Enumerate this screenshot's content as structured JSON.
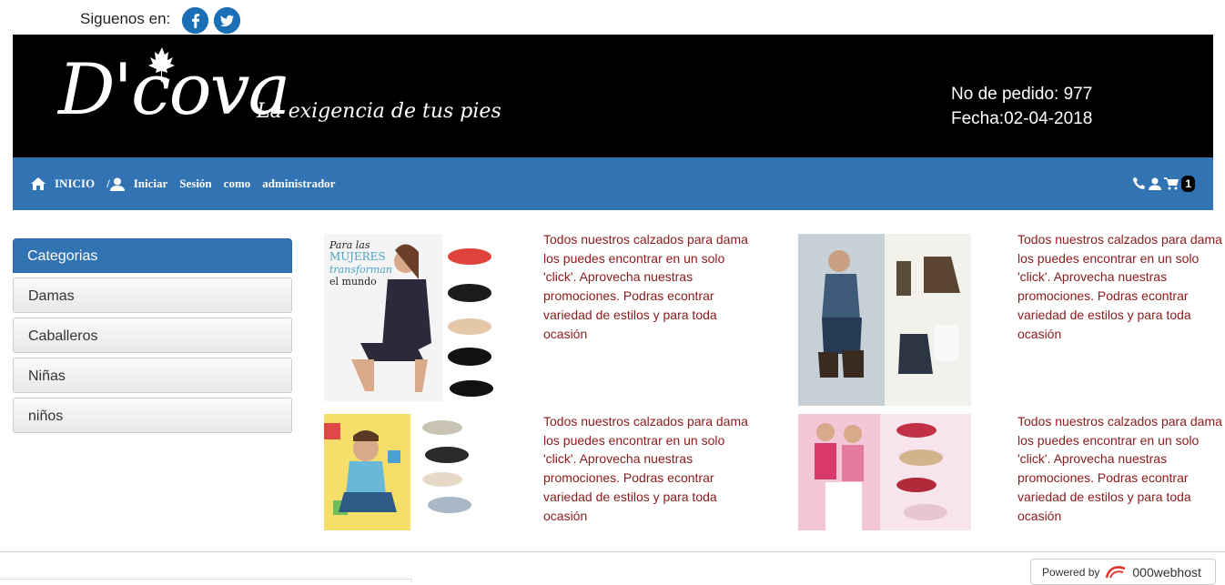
{
  "header": {
    "follow_label": "Siguenos en:",
    "social": [
      "facebook-icon",
      "twitter-icon"
    ],
    "brand_name": "D'cova",
    "brand_tagline": "La exigencia de tus pies",
    "order_label": "No de pedido: 977",
    "date_label": "Fecha:02-04-2018"
  },
  "nav": {
    "home": "INICIO",
    "separator": "/",
    "login_words": [
      "Iniciar",
      "Sesión",
      "como",
      "administrador"
    ],
    "cart_count": "1"
  },
  "sidebar": {
    "title": "Categorias",
    "items": [
      "Damas",
      "Caballeros",
      "Niñas",
      "niños"
    ]
  },
  "products": [
    {
      "text": "Todos nuestros calzados para dama los puedes encontrar en un solo 'click'. Aprovecha nuestras promociones. Podras econtrar variedad de estilos y para toda ocasión",
      "image_caption": "Para las MUJERES que transforman el mundo"
    },
    {
      "text": "Todos nuestros calzados para dama los puedes encontrar en un solo 'click'. Aprovecha nuestras promociones. Podras econtrar variedad de estilos y para toda ocasión"
    },
    {
      "text": "Todos nuestros calzados para dama los puedes encontrar en un solo 'click'. Aprovecha nuestras promociones. Podras econtrar variedad de estilos y para toda ocasión"
    },
    {
      "text": "Todos nuestros calzados para dama los puedes encontrar en un solo 'click'. Aprovecha nuestras promociones. Podras econtrar variedad de estilos y para toda ocasión"
    }
  ],
  "footer": {
    "powered_label": "Powered by",
    "powered_brand": "000webhost"
  },
  "colors": {
    "nav_blue": "#3273b3",
    "product_text": "#8b1a1a",
    "banner_bg": "#000000"
  }
}
